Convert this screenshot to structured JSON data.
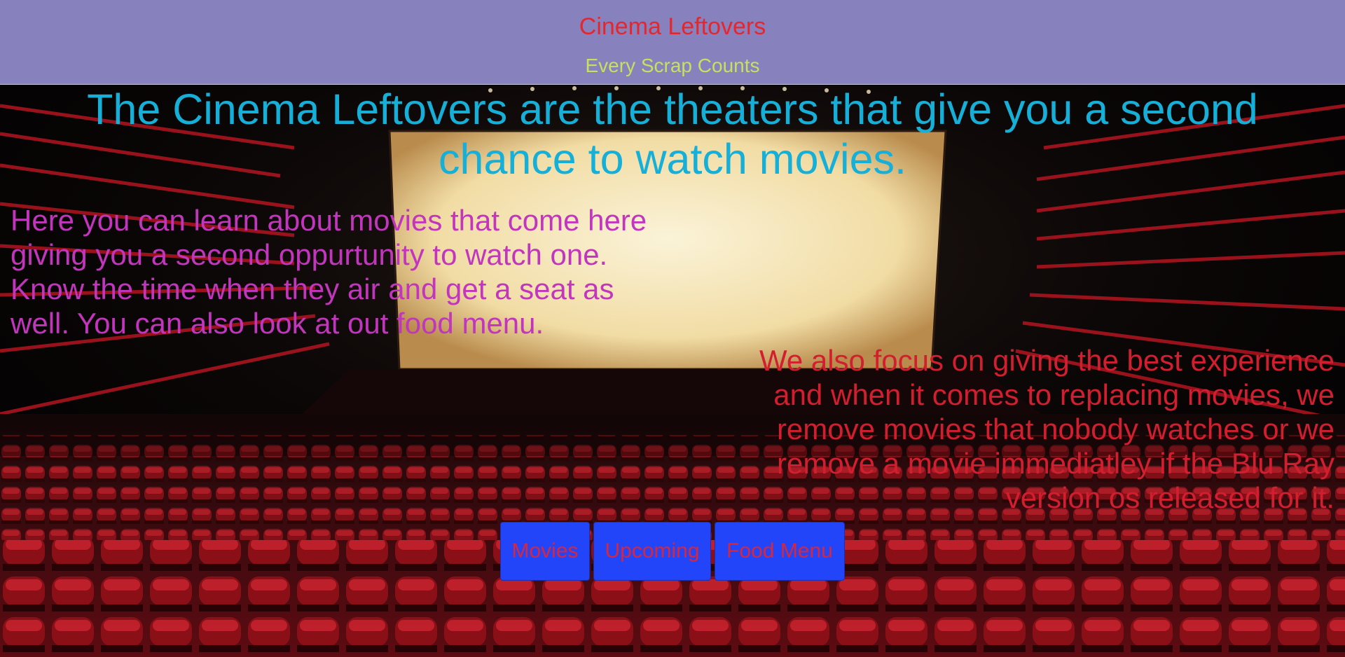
{
  "header": {
    "title": "Cinema Leftovers",
    "tagline": "Every Scrap Counts"
  },
  "hero": {
    "headline": "The Cinema Leftovers are the theaters that give you a second chance to watch movies.",
    "intro": "Here you can learn about movies that come here giving you a second oppurtunity to watch one. Know the time when they air and get a seat as well. You can also look at out food menu.",
    "focus": "We also focus on giving the best experience and when it comes to replacing movies, we remove movies that nobody watches or we remove a movie immediatley if the Blu Ray version os released for it."
  },
  "nav": {
    "movies": "Movies",
    "upcoming": "Upcoming",
    "food_menu": "Food Menu"
  },
  "colors": {
    "header_bg": "#8781be",
    "title": "#e5272d",
    "tagline": "#c6e05f",
    "headline": "#15afd8",
    "intro": "#c235bd",
    "focus": "#d21e2f",
    "button_bg": "#2345fa",
    "button_text": "#d8263b"
  }
}
